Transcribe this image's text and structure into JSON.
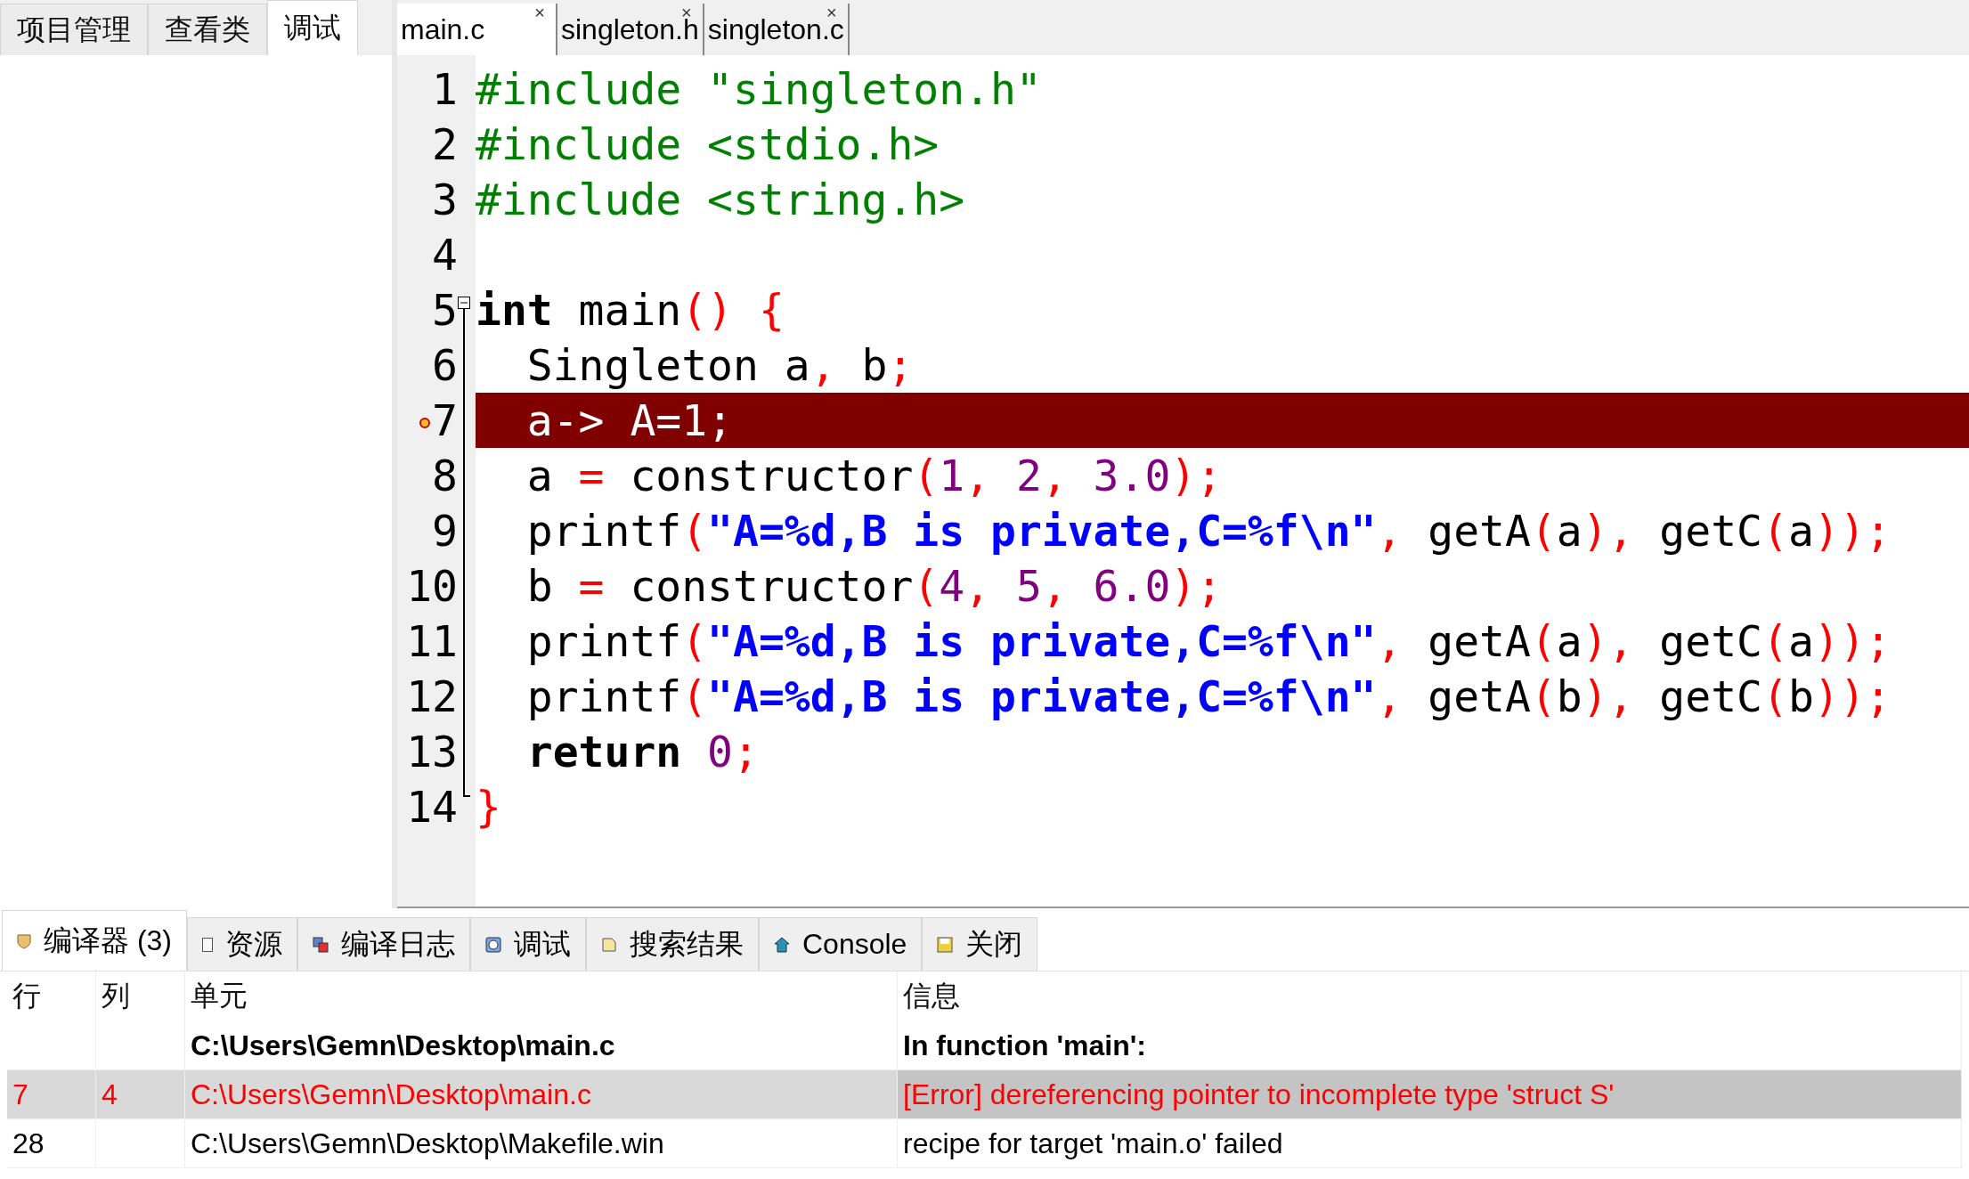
{
  "side_tabs": [
    {
      "label": "项目管理",
      "selected": false
    },
    {
      "label": "查看类",
      "selected": false
    },
    {
      "label": "调试",
      "selected": true
    }
  ],
  "file_tabs": [
    {
      "label": "main.c",
      "close": "×",
      "selected": true
    },
    {
      "label": "singleton.h",
      "close": "×",
      "selected": false
    },
    {
      "label": "singleton.c",
      "close": "×",
      "selected": false
    }
  ],
  "code_lines": [
    {
      "number": "1",
      "tokens": [
        {
          "kind": "pre",
          "text": "#include \"singleton.h\""
        }
      ]
    },
    {
      "number": "2",
      "tokens": [
        {
          "kind": "pre",
          "text": "#include <stdio.h>"
        }
      ]
    },
    {
      "number": "3",
      "tokens": [
        {
          "kind": "pre",
          "text": "#include <string.h>"
        }
      ]
    },
    {
      "number": "4"
    },
    {
      "number": "5",
      "expanded": true,
      "tokens": [
        {
          "kind": "kw",
          "text": "int"
        },
        {
          "kind": "id",
          "text": " main"
        },
        {
          "kind": "op",
          "text": "() {"
        }
      ]
    },
    {
      "number": "6",
      "tokens": [
        {
          "kind": "id",
          "text": "  Singleton a"
        },
        {
          "kind": "op",
          "text": ","
        },
        {
          "kind": "id",
          "text": " b"
        },
        {
          "kind": "op",
          "text": ";"
        }
      ]
    },
    {
      "number": "7",
      "error": true,
      "tokens": [
        {
          "kind": "id",
          "text": "  a-> A=1;"
        }
      ]
    },
    {
      "number": "8",
      "tokens": [
        {
          "kind": "id",
          "text": "  a "
        },
        {
          "kind": "op",
          "text": "="
        },
        {
          "kind": "id",
          "text": " constructor"
        },
        {
          "kind": "op",
          "text": "("
        },
        {
          "kind": "num",
          "text": "1"
        },
        {
          "kind": "op",
          "text": ", "
        },
        {
          "kind": "num",
          "text": "2"
        },
        {
          "kind": "op",
          "text": ", "
        },
        {
          "kind": "num",
          "text": "3.0"
        },
        {
          "kind": "op",
          "text": ");"
        }
      ]
    },
    {
      "number": "9",
      "tokens": [
        {
          "kind": "id",
          "text": "  printf"
        },
        {
          "kind": "op",
          "text": "("
        },
        {
          "kind": "str",
          "text": "\"A=%d,B is private,C=%f\\n\""
        },
        {
          "kind": "op",
          "text": ","
        },
        {
          "kind": "id",
          "text": " getA"
        },
        {
          "kind": "op",
          "text": "("
        },
        {
          "kind": "id",
          "text": "a"
        },
        {
          "kind": "op",
          "text": "),"
        },
        {
          "kind": "id",
          "text": " getC"
        },
        {
          "kind": "op",
          "text": "("
        },
        {
          "kind": "id",
          "text": "a"
        },
        {
          "kind": "op",
          "text": "));"
        }
      ]
    },
    {
      "number": "10",
      "tokens": [
        {
          "kind": "id",
          "text": "  b "
        },
        {
          "kind": "op",
          "text": "="
        },
        {
          "kind": "id",
          "text": " constructor"
        },
        {
          "kind": "op",
          "text": "("
        },
        {
          "kind": "num",
          "text": "4"
        },
        {
          "kind": "op",
          "text": ", "
        },
        {
          "kind": "num",
          "text": "5"
        },
        {
          "kind": "op",
          "text": ", "
        },
        {
          "kind": "num",
          "text": "6.0"
        },
        {
          "kind": "op",
          "text": ");"
        }
      ]
    },
    {
      "number": "11",
      "tokens": [
        {
          "kind": "id",
          "text": "  printf"
        },
        {
          "kind": "op",
          "text": "("
        },
        {
          "kind": "str",
          "text": "\"A=%d,B is private,C=%f\\n\""
        },
        {
          "kind": "op",
          "text": ","
        },
        {
          "kind": "id",
          "text": " getA"
        },
        {
          "kind": "op",
          "text": "("
        },
        {
          "kind": "id",
          "text": "a"
        },
        {
          "kind": "op",
          "text": "),"
        },
        {
          "kind": "id",
          "text": " getC"
        },
        {
          "kind": "op",
          "text": "("
        },
        {
          "kind": "id",
          "text": "a"
        },
        {
          "kind": "op",
          "text": "));"
        }
      ]
    },
    {
      "number": "12",
      "tokens": [
        {
          "kind": "id",
          "text": "  printf"
        },
        {
          "kind": "op",
          "text": "("
        },
        {
          "kind": "str",
          "text": "\"A=%d,B is private,C=%f\\n\""
        },
        {
          "kind": "op",
          "text": ","
        },
        {
          "kind": "id",
          "text": " getA"
        },
        {
          "kind": "op",
          "text": "("
        },
        {
          "kind": "id",
          "text": "b"
        },
        {
          "kind": "op",
          "text": "),"
        },
        {
          "kind": "id",
          "text": " getC"
        },
        {
          "kind": "op",
          "text": "("
        },
        {
          "kind": "id",
          "text": "b"
        },
        {
          "kind": "op",
          "text": "));"
        }
      ]
    },
    {
      "number": "13",
      "tokens": [
        {
          "kind": "kw",
          "text": "  return"
        },
        {
          "kind": "num",
          "text": " 0"
        },
        {
          "kind": "op",
          "text": ";"
        }
      ]
    },
    {
      "number": "14",
      "tokens": [
        {
          "kind": "op",
          "text": "}"
        }
      ]
    }
  ],
  "bottom_tabs": [
    {
      "label": "编译器 (3)",
      "selected": true
    },
    {
      "label": "资源",
      "selected": false
    },
    {
      "label": "编译日志",
      "selected": false
    },
    {
      "label": "调试",
      "selected": false
    },
    {
      "label": "搜索结果",
      "selected": false
    },
    {
      "label": "Console",
      "selected": false
    },
    {
      "label": "关闭",
      "selected": false
    }
  ],
  "table": {
    "columns": [
      "行",
      "列",
      "单元",
      "信息"
    ],
    "rows": [
      {
        "kind": "header",
        "selected": false,
        "cells": [
          null,
          null,
          "C:\\Users\\Gemn\\Desktop\\main.c",
          "In function 'main':"
        ]
      },
      {
        "kind": "error",
        "selected": true,
        "cells": [
          "7",
          "4",
          "C:\\Users\\Gemn\\Desktop\\main.c",
          "[Error] dereferencing pointer to incomplete type 'struct S'"
        ]
      },
      {
        "kind": "normal",
        "selected": false,
        "cells": [
          "28",
          null,
          "C:\\Users\\Gemn\\Desktop\\Makefile.win",
          "recipe for target 'main.o' failed"
        ]
      }
    ]
  }
}
